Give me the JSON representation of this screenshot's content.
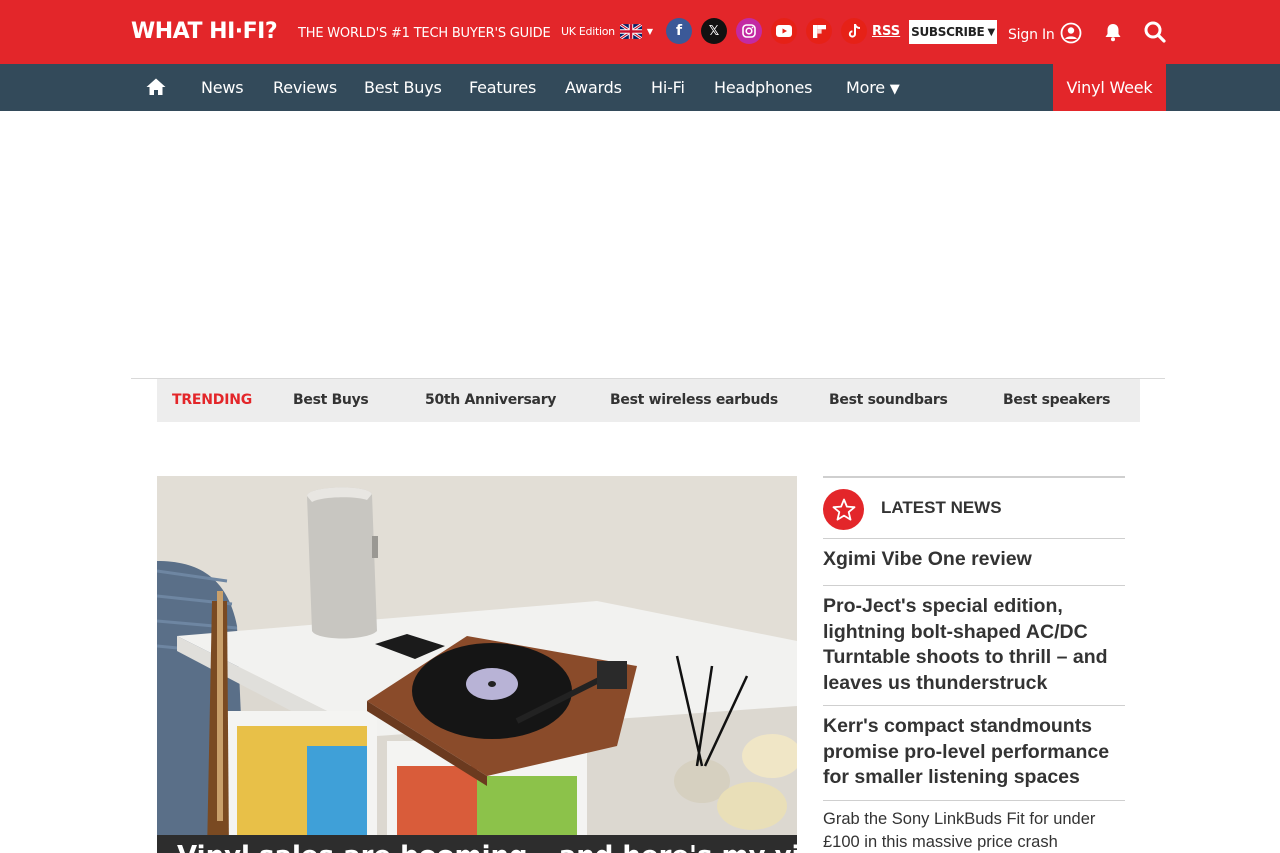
{
  "header": {
    "logo": "WHAT HI·FI?",
    "tagline": "THE WORLD'S #1 TECH BUYER'S GUIDE",
    "edition": "UK Edition",
    "rss": "RSS",
    "subscribe": "SUBSCRIBE",
    "signin": "Sign In",
    "accent_color": "#e3262a"
  },
  "nav": {
    "items": [
      "News",
      "Reviews",
      "Best Buys",
      "Features",
      "Awards",
      "Hi-Fi",
      "Headphones",
      "More"
    ],
    "highlight": "Vinyl Week",
    "bg_color": "#334a5a"
  },
  "trending": {
    "label": "TRENDING",
    "items": [
      "Best Buys",
      "50th Anniversary",
      "Best wireless earbuds",
      "Best soundbars",
      "Best speakers"
    ]
  },
  "hero": {
    "caption": "Vinyl sales are booming – and here's my vinyl set-up"
  },
  "latest": {
    "title": "LATEST NEWS",
    "items": [
      "Xgimi Vibe One review",
      "Pro-Ject's special edition, lightning bolt-shaped AC/DC Turntable shoots to thrill – and leaves us thunderstruck",
      "Kerr's compact standmounts promise pro-level performance for smaller listening spaces",
      "Grab the Sony LinkBuds Fit for under £100 in this massive price crash"
    ]
  }
}
